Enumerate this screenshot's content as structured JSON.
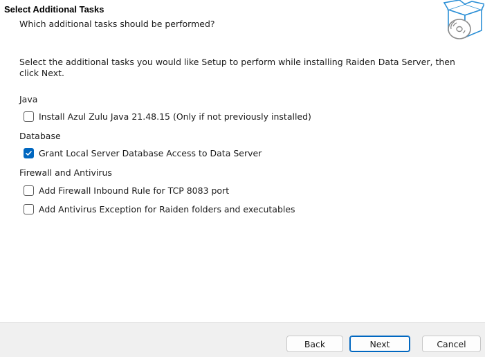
{
  "header": {
    "title": "Select Additional Tasks",
    "subtitle": "Which additional tasks should be performed?",
    "icon": "setup-box-disc-icon"
  },
  "main": {
    "description": "Select the additional tasks you would like Setup to perform while installing Raiden Data Server, then click Next.",
    "groups": [
      {
        "label": "Java",
        "tasks": [
          {
            "label": "Install Azul Zulu Java 21.48.15 (Only if not previously installed)",
            "checked": false
          }
        ]
      },
      {
        "label": "Database",
        "tasks": [
          {
            "label": "Grant Local Server Database Access to Data Server",
            "checked": true
          }
        ]
      },
      {
        "label": "Firewall and Antivirus",
        "tasks": [
          {
            "label": "Add Firewall Inbound Rule for TCP 8083 port",
            "checked": false
          },
          {
            "label": "Add Antivirus Exception for Raiden folders and executables",
            "checked": false
          }
        ]
      }
    ]
  },
  "footer": {
    "back_label": "Back",
    "next_label": "Next",
    "cancel_label": "Cancel"
  },
  "colors": {
    "accent": "#0067c0",
    "footer_bg": "#f0f0f0"
  }
}
